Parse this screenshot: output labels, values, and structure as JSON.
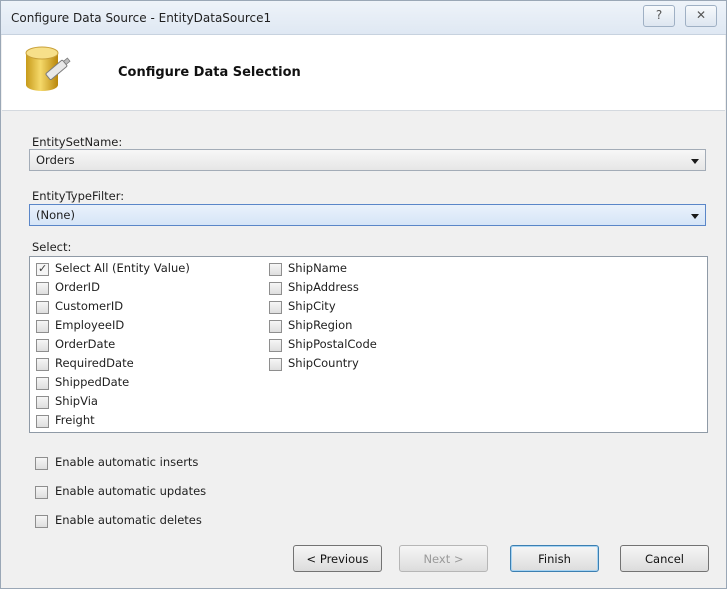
{
  "window": {
    "title": "Configure Data Source - EntityDataSource1",
    "help_label": "?",
    "close_label": "✕"
  },
  "header": {
    "title": "Configure Data Selection"
  },
  "entity_set": {
    "label": "EntitySetName:",
    "value": "Orders"
  },
  "type_filter": {
    "label": "EntityTypeFilter:",
    "value": "(None)"
  },
  "select": {
    "label": "Select:",
    "col1": [
      {
        "label": "Select All (Entity Value)",
        "checked": true
      },
      {
        "label": "OrderID",
        "checked": false
      },
      {
        "label": "CustomerID",
        "checked": false
      },
      {
        "label": "EmployeeID",
        "checked": false
      },
      {
        "label": "OrderDate",
        "checked": false
      },
      {
        "label": "RequiredDate",
        "checked": false
      },
      {
        "label": "ShippedDate",
        "checked": false
      },
      {
        "label": "ShipVia",
        "checked": false
      },
      {
        "label": "Freight",
        "checked": false
      }
    ],
    "col2": [
      {
        "label": "ShipName",
        "checked": false
      },
      {
        "label": "ShipAddress",
        "checked": false
      },
      {
        "label": "ShipCity",
        "checked": false
      },
      {
        "label": "ShipRegion",
        "checked": false
      },
      {
        "label": "ShipPostalCode",
        "checked": false
      },
      {
        "label": "ShipCountry",
        "checked": false
      }
    ]
  },
  "options": {
    "inserts": "Enable automatic inserts",
    "updates": "Enable automatic updates",
    "deletes": "Enable automatic deletes"
  },
  "buttons": {
    "previous": "< Previous",
    "next": "Next >",
    "finish": "Finish",
    "cancel": "Cancel"
  }
}
